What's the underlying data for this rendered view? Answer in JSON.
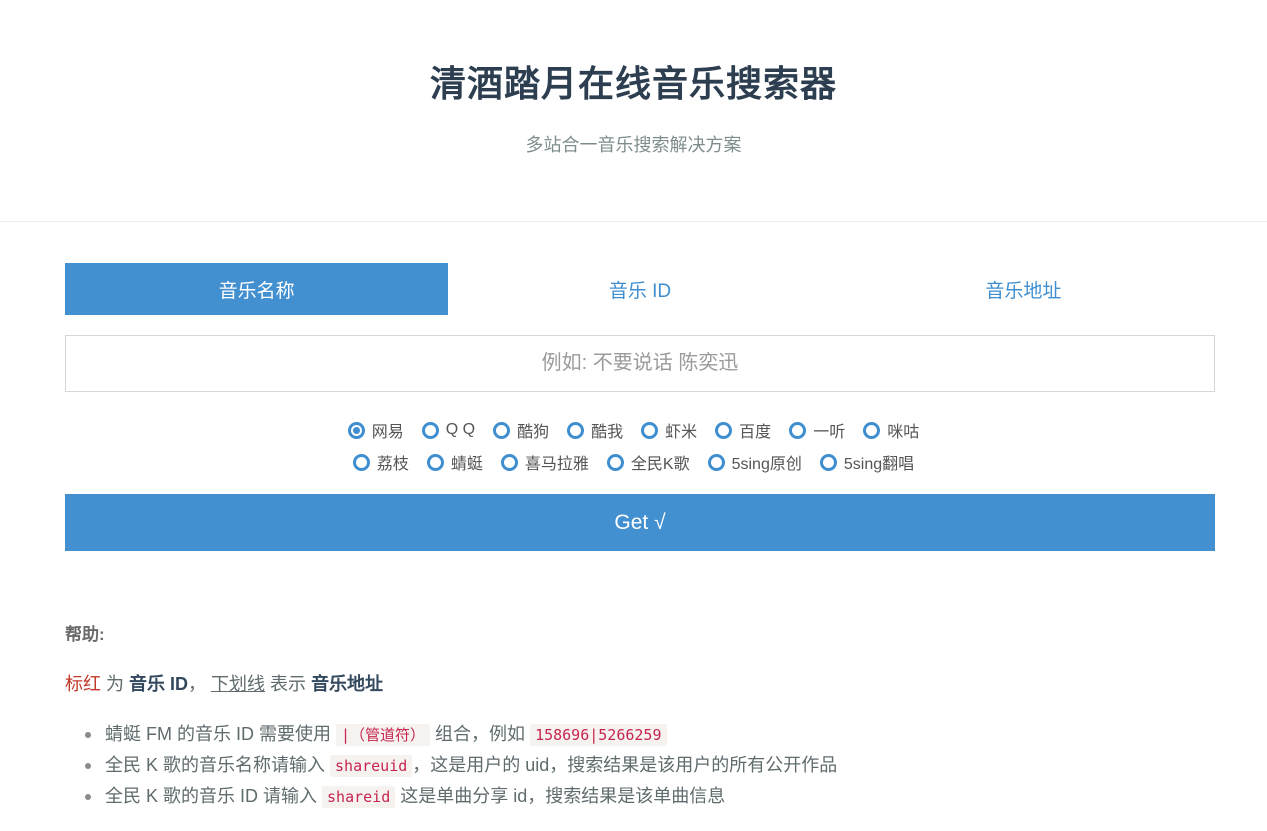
{
  "header": {
    "title": "清酒踏月在线音乐搜索器",
    "subtitle": "多站合一音乐搜索解决方案"
  },
  "tabs": [
    {
      "label": "音乐名称",
      "active": true
    },
    {
      "label": "音乐 ID",
      "active": false
    },
    {
      "label": "音乐地址",
      "active": false
    }
  ],
  "search": {
    "placeholder": "例如: 不要说话 陈奕迅",
    "value": ""
  },
  "sources": {
    "selected": "网易",
    "row1": [
      "网易",
      "Q Q",
      "酷狗",
      "酷我",
      "虾米",
      "百度",
      "一听",
      "咪咕"
    ],
    "row2": [
      "荔枝",
      "蜻蜓",
      "喜马拉雅",
      "全民K歌",
      "5sing原创",
      "5sing翻唱"
    ]
  },
  "get_button": {
    "label": "Get √"
  },
  "help": {
    "title": "帮助:",
    "legend": {
      "red": "标红",
      "t1": " 为 ",
      "b1": "音乐 ID",
      "t2": "， ",
      "underline": "下划线",
      "t3": " 表示 ",
      "b2": "音乐地址"
    },
    "items": [
      {
        "pre": "蜻蜓 FM 的音乐 ID 需要使用 ",
        "code": "|（管道符）",
        "mid": " 组合，例如 ",
        "code2": "158696|5266259",
        "post": ""
      },
      {
        "pre": "全民 K 歌的音乐名称请输入 ",
        "code": "shareuid",
        "mid": "，这是用户的 uid，搜索结果是该用户的所有公开作品",
        "code2": "",
        "post": ""
      },
      {
        "pre": "全民 K 歌的音乐 ID 请输入 ",
        "code": "shareid",
        "mid": " 这是单曲分享 id，搜索结果是该单曲信息",
        "code2": "",
        "post": ""
      }
    ]
  },
  "colors": {
    "accent": "#4390d0",
    "title": "#2c3e50",
    "highlight_red": "#c0392b"
  }
}
